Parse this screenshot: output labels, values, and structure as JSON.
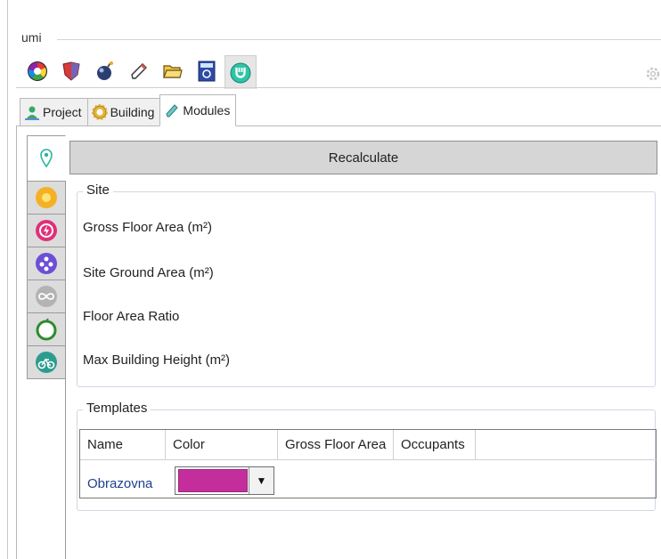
{
  "panel": {
    "title": "umi"
  },
  "toolbar": {
    "icons": [
      "color-wheel-icon",
      "shield-icon",
      "bomb-icon",
      "pencil-icon",
      "folder-icon",
      "calculator-icon",
      "umi-logo-icon",
      "gear-icon"
    ],
    "active_index": 6
  },
  "tabs": [
    {
      "label": "Project",
      "icon": "user-pin-icon"
    },
    {
      "label": "Building",
      "icon": "gear-cog-icon"
    },
    {
      "label": "Modules",
      "icon": "pencil-icon",
      "active": true
    }
  ],
  "side_tabs": [
    "location-pin-icon",
    "sun-icon",
    "energy-icon",
    "network-icon",
    "infinity-icon",
    "apple-icon",
    "bicycle-icon"
  ],
  "recalculate_label": "Recalculate",
  "site": {
    "legend": "Site",
    "rows": [
      "Gross Floor Area (m²)",
      "Site Ground Area (m²)",
      "Floor Area Ratio",
      "Max Building Height (m²)"
    ]
  },
  "templates": {
    "legend": "Templates",
    "columns": [
      "Name",
      "Color",
      "Gross Floor Area",
      "Occupants"
    ],
    "rows": [
      {
        "name": "Obrazovna",
        "color": "#c42e9c"
      }
    ]
  },
  "colors": {
    "accent": "#c42e9c",
    "name_link": "#1f3f8f"
  }
}
